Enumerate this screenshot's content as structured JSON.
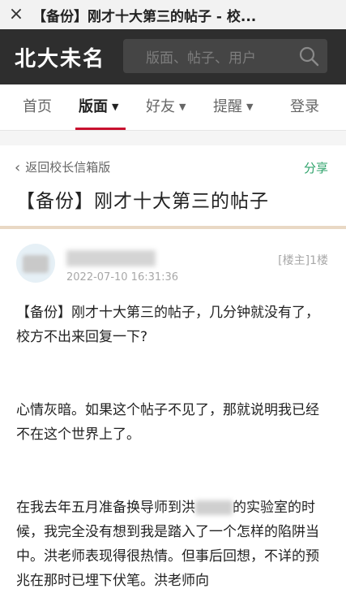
{
  "webview": {
    "close_glyph": "×",
    "title": "【备份】刚才十大第三的帖子 - 校...",
    "more_glyph": "⋮"
  },
  "site": {
    "logo": "北大未名",
    "search_placeholder": "版面、帖子、用户"
  },
  "nav": {
    "items": [
      {
        "label": "首页",
        "caret": ""
      },
      {
        "label": "版面",
        "caret": "▼"
      },
      {
        "label": "好友",
        "caret": "▼"
      },
      {
        "label": "提醒",
        "caret": "▼"
      },
      {
        "label": "登录",
        "caret": ""
      }
    ],
    "active": "版面",
    "accent_color": "#c8102e"
  },
  "post_header": {
    "back_label": "返回校长信箱版",
    "share_label": "分享",
    "title": "【备份】刚才十大第三的帖子"
  },
  "post": {
    "timestamp": "2022-07-10 16:31:36",
    "floor": "[楼主]1楼",
    "paragraphs": {
      "p1": "【备份】刚才十大第三的帖子，几分钟就没有了，校方不出来回复一下?",
      "p2": "心情灰暗。如果这个帖子不见了，那就说明我已经不在这个世界上了。",
      "p3_before": "在我去年五月准备换导师到洪",
      "p3_after": "的实验室的时候，我完全没有想到我是踏入了一个怎样的陷阱当中。洪老师表现得很热情。但事后回想，不详的预兆在那时已埋下伏笔。洪老师向"
    }
  },
  "colors": {
    "header_bg": "#2e2e2e",
    "share_green": "#2fa36b",
    "divider": "#e9d8c4"
  }
}
